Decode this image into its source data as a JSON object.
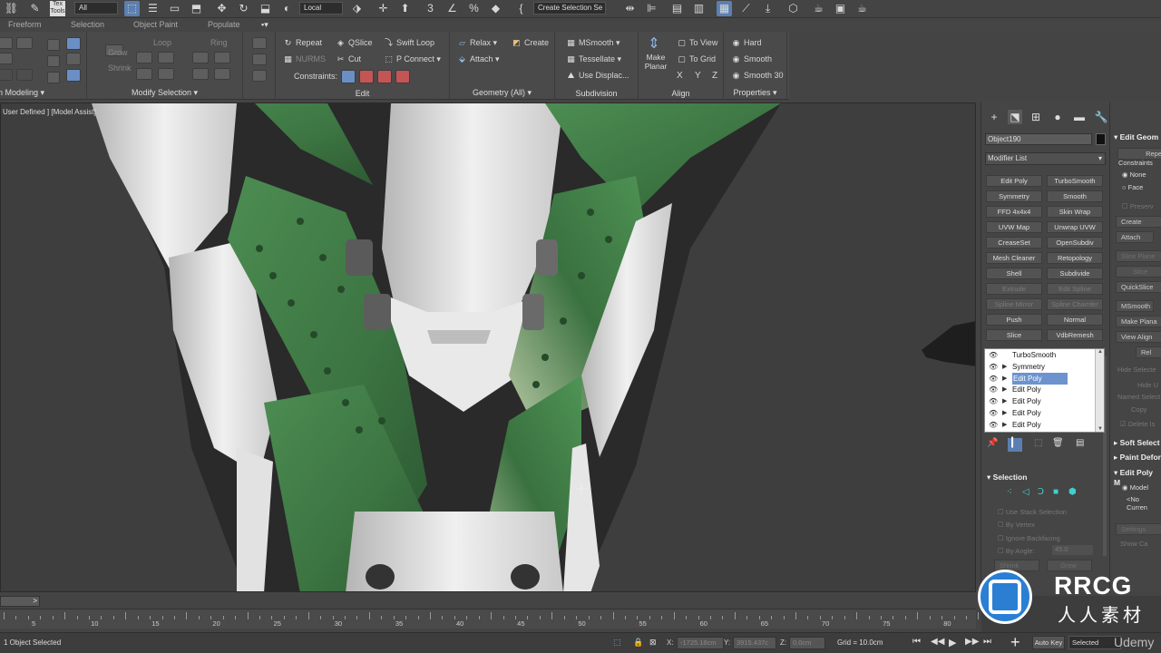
{
  "toolbar": {
    "selection_filter": "All",
    "ref_coord": "Local",
    "named_selection": "Create Selection Se"
  },
  "ribbon_tabs": [
    "Freeform",
    "Selection",
    "Object Paint",
    "Populate"
  ],
  "ribbon": {
    "polygon_modeling": {
      "label": "n Modeling"
    },
    "modify_selection": {
      "label": "Modify Selection",
      "grow": "Grow",
      "shrink": "Shrink",
      "loop": "Loop",
      "ring": "Ring"
    },
    "edit": {
      "label": "Edit",
      "repeat": "Repeat",
      "qslice": "QSlice",
      "swift_loop": "Swift Loop",
      "nurms": "NURMS",
      "cut": "Cut",
      "p_connect": "P Connect",
      "constraints": "Constraints:"
    },
    "geometry": {
      "label": "Geometry (All)",
      "relax": "Relax",
      "create": "Create",
      "attach": "Attach"
    },
    "subdivision": {
      "label": "Subdivision",
      "msmooth": "MSmooth",
      "tessellate": "Tessellate",
      "use_displace": "Use Displac..."
    },
    "align": {
      "label": "Align",
      "make_planar": "Make Planar",
      "to_view": "To View",
      "to_grid": "To Grid",
      "x": "X",
      "y": "Y",
      "z": "Z"
    },
    "properties": {
      "label": "Properties",
      "hard": "Hard",
      "smooth": "Smooth",
      "smooth30": "Smooth 30"
    }
  },
  "viewport": {
    "label": "User Defined ] [Model Assist]"
  },
  "command_panel": {
    "object_name": "Object190",
    "modifier_list": "Modifier List",
    "modifier_buttons": [
      [
        "Edit Poly",
        "TurboSmooth"
      ],
      [
        "Symmetry",
        "Smooth"
      ],
      [
        "FFD 4x4x4",
        "Skin Wrap"
      ],
      [
        "UVW Map",
        "Unwrap UVW"
      ],
      [
        "CreaseSet",
        "OpenSubdiv"
      ],
      [
        "Mesh Cleaner",
        "Retopology"
      ],
      [
        "Shell",
        "Subdivide"
      ],
      [
        "Extrude",
        "Edit Spline"
      ],
      [
        "Spline Mirror",
        "Spline Chamfer"
      ],
      [
        "Push",
        "Normal"
      ],
      [
        "Slice",
        "VdbRemesh"
      ]
    ],
    "stack": [
      {
        "label": "TurboSmooth",
        "selected": false,
        "expand": false
      },
      {
        "label": "Symmetry",
        "selected": false,
        "expand": true
      },
      {
        "label": "Edit Poly",
        "selected": true,
        "expand": true
      },
      {
        "label": "Edit Poly",
        "selected": false,
        "expand": true
      },
      {
        "label": "Edit Poly",
        "selected": false,
        "expand": true
      },
      {
        "label": "Edit Poly",
        "selected": false,
        "expand": true
      },
      {
        "label": "Edit Poly",
        "selected": false,
        "expand": true
      }
    ],
    "selection": {
      "title": "Selection",
      "use_stack": "Use Stack Selection",
      "by_vertex": "By Vertex",
      "ignore_backfacing": "Ignore Backfacing",
      "by_angle": "By Angle:",
      "by_angle_value": "45.0",
      "shrink": "Shrink",
      "grow": "Grow"
    },
    "right_rollout": {
      "edit_geometry": "Edit Geom",
      "repeat": "Repe",
      "constraints": "Constraints",
      "none": "None",
      "face": "Face",
      "preserve": "Preserv",
      "create": "Create",
      "attach": "Attach",
      "slice_plane": "Slice Plane",
      "slice": "Slice",
      "quickslice": "QuickSlice",
      "msmooth": "MSmooth",
      "make_planar": "Make Plana",
      "view_align": "View Align",
      "rel": "Rel",
      "hide_selected": "Hide Selecte",
      "hide_unselected": "Hide U",
      "named_selections": "Named Select",
      "copy": "Copy",
      "delete_isolated": "Delete Is",
      "soft_selection": "Soft Select",
      "paint_deform": "Paint Defor",
      "edit_poly_mode": "Edit Poly M",
      "model": "Model",
      "no_current": "<No Curren",
      "settings": "Settings",
      "show_cage": "Show Ca"
    }
  },
  "timeline": {
    "ticks": [
      "5",
      "10",
      "15",
      "20",
      "25",
      "30",
      "35",
      "40",
      "45",
      "50",
      "55",
      "60",
      "65",
      "70",
      "75",
      "80"
    ],
    "scroll_arrow": ">"
  },
  "status": {
    "selected_text": "1 Object Selected",
    "x_label": "X:",
    "x_value": "-1725.18cm",
    "y_label": "Y:",
    "y_value": "3915.437c",
    "z_label": "Z:",
    "z_value": "0.0cm",
    "grid": "Grid = 10.0cm",
    "auto_key": "Auto Key",
    "selected_dd": "Selected"
  },
  "watermark": {
    "text_en": "RRCG",
    "text_cn": "人人素材",
    "udemy": "Udemy"
  },
  "colors": {
    "viewport_bg": "#3e3e3e",
    "armor_green": "#3f7a45",
    "armor_white": "#d9d9d9",
    "stack_selected": "#6d93cf"
  }
}
